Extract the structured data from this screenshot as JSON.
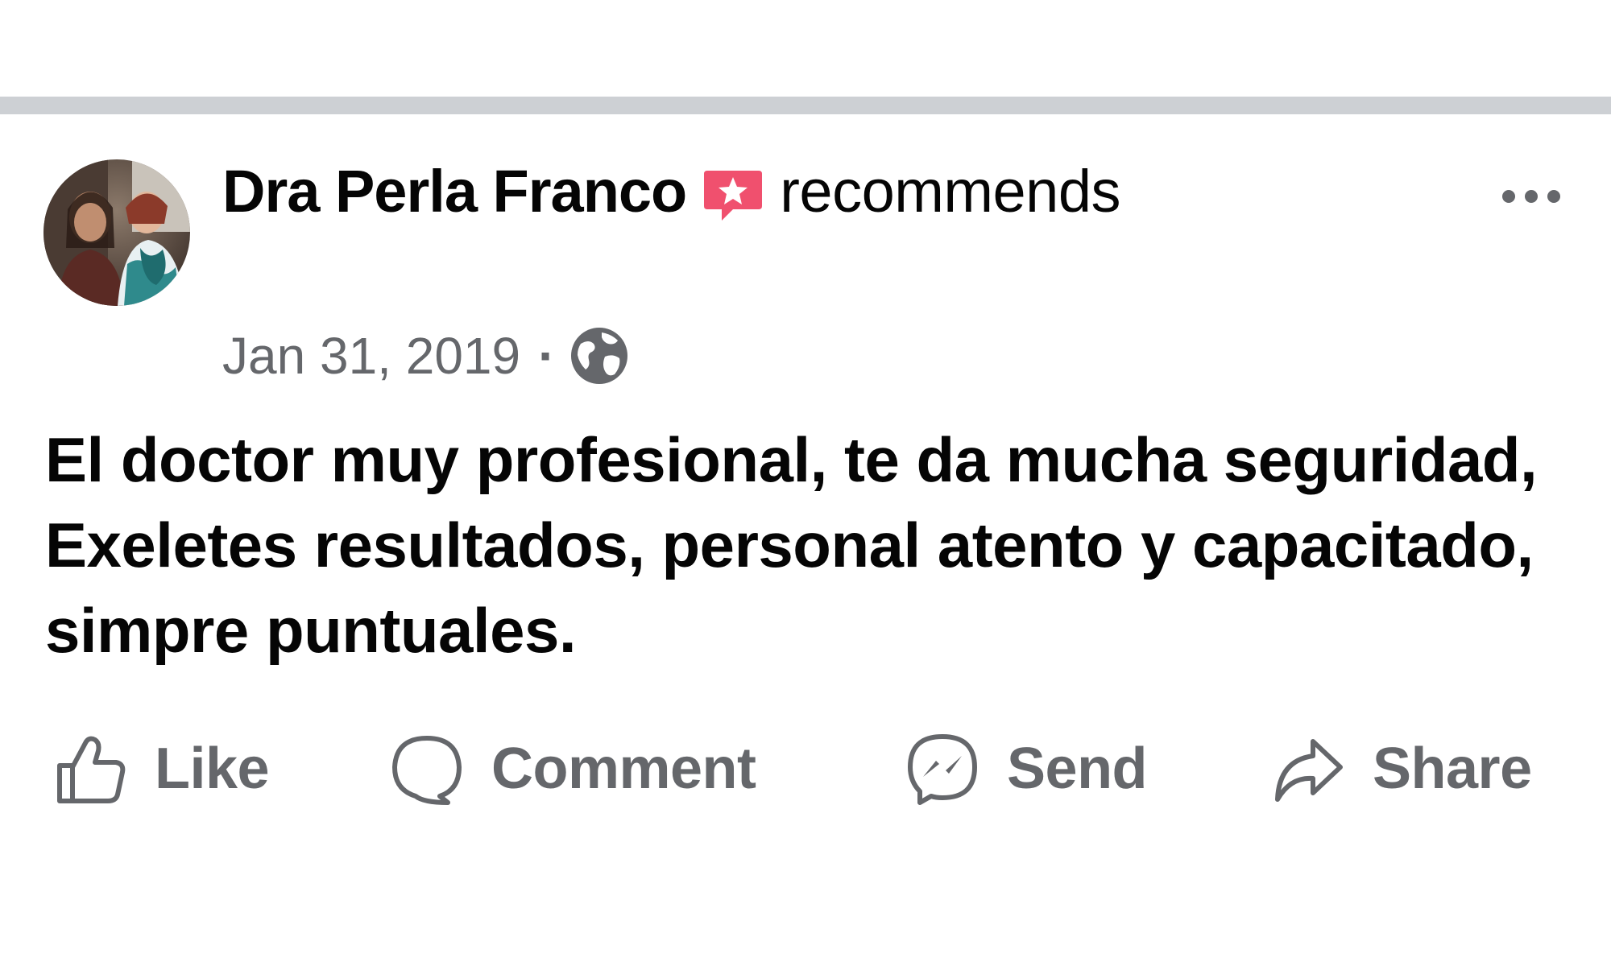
{
  "post": {
    "author": "Dra Perla Franco",
    "action_text": "recommends",
    "date": "Jan 31, 2019",
    "separator": "·",
    "audience_icon": "globe-icon",
    "body": "El doctor muy profesional, te da mucha seguridad, Exeletes resultados, personal atento y capacitado, simpre puntuales.",
    "more_icon": "more-options-icon",
    "recommend_icon": "recommendation-star-icon"
  },
  "actions": {
    "like": "Like",
    "comment": "Comment",
    "send": "Send",
    "share": "Share"
  },
  "colors": {
    "primary_text": "#050505",
    "secondary_text": "#65676b",
    "divider": "#cdd0d4",
    "recommend_badge": "#f0506e"
  }
}
